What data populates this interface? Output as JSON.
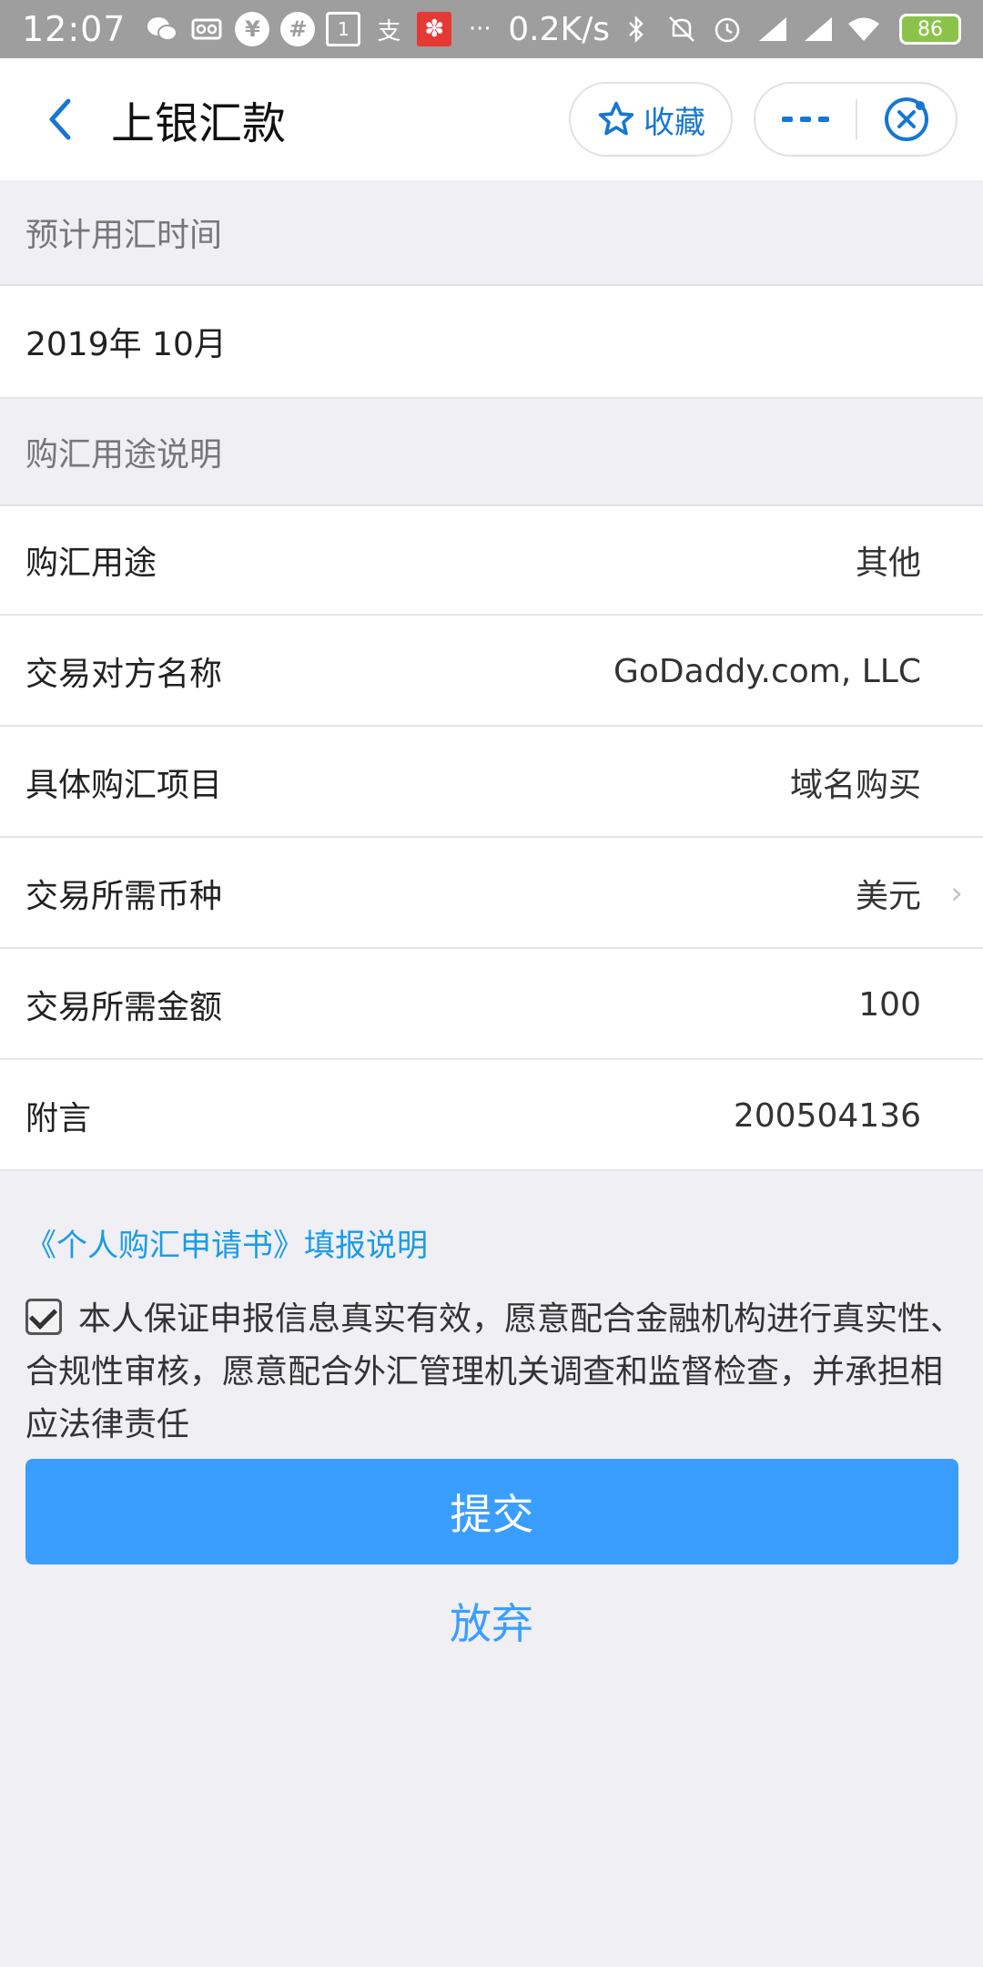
{
  "statusbar": {
    "time": "12:07",
    "icons_left": [
      "wechat-icon",
      "voicemail-icon",
      "yuan-icon",
      "slack-icon",
      "calendar-icon",
      "alipay-icon",
      "app-red-icon",
      "more-dots-icon"
    ],
    "yuan_glyph": "¥",
    "calendar_glyph": "1",
    "alipay_glyph": "支",
    "more_glyph": "···",
    "net_speed": "0.2K/s",
    "battery": "86"
  },
  "header": {
    "title": "上银汇款",
    "favorite_label": "收藏",
    "accent": "#1677d2"
  },
  "sections": {
    "time_header": "预计用汇时间",
    "time_value": "2019年 10月",
    "purpose_header": "购汇用途说明"
  },
  "rows": [
    {
      "label": "购汇用途",
      "value": "其他"
    },
    {
      "label": "交易对方名称",
      "value": "GoDaddy.com, LLC"
    },
    {
      "label": "具体购汇项目",
      "value": "域名购买"
    },
    {
      "label": "交易所需币种",
      "value": "美元",
      "chevron": "›"
    },
    {
      "label": "交易所需金额",
      "value": "100"
    },
    {
      "label": "附言",
      "value": "200504136"
    }
  ],
  "notice_link": "《个人购汇申请书》填报说明",
  "agreement": "本人保证申报信息真实有效，愿意配合金融机构进行真实性、合规性审核，愿意配合外汇管理机关调查和监督检查，并承担相应法律责任",
  "agreement_checked": true,
  "submit_label": "提交",
  "cancel_label": "放弃",
  "colors": {
    "primary_button": "#3a9eff",
    "link": "#1a9be6",
    "background": "#efeff4"
  }
}
